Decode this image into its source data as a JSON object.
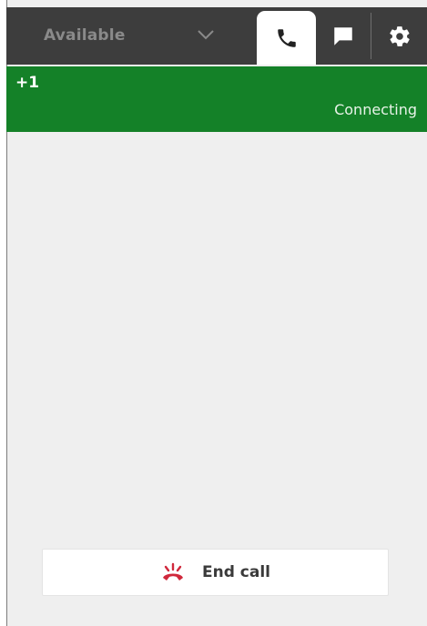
{
  "status": {
    "label": "Available"
  },
  "tabs": [
    {
      "icon": "phone-icon",
      "active": true
    },
    {
      "icon": "chat-icon",
      "active": false
    },
    {
      "icon": "gear-icon",
      "active": false
    }
  ],
  "call": {
    "country_code": "+1",
    "number": "",
    "status": "Connecting"
  },
  "actions": {
    "end_call_label": "End call"
  },
  "colors": {
    "top_bar": "#3d3d3d",
    "banner": "#148128",
    "end_call_icon": "#d0283c",
    "background": "#efefef"
  }
}
